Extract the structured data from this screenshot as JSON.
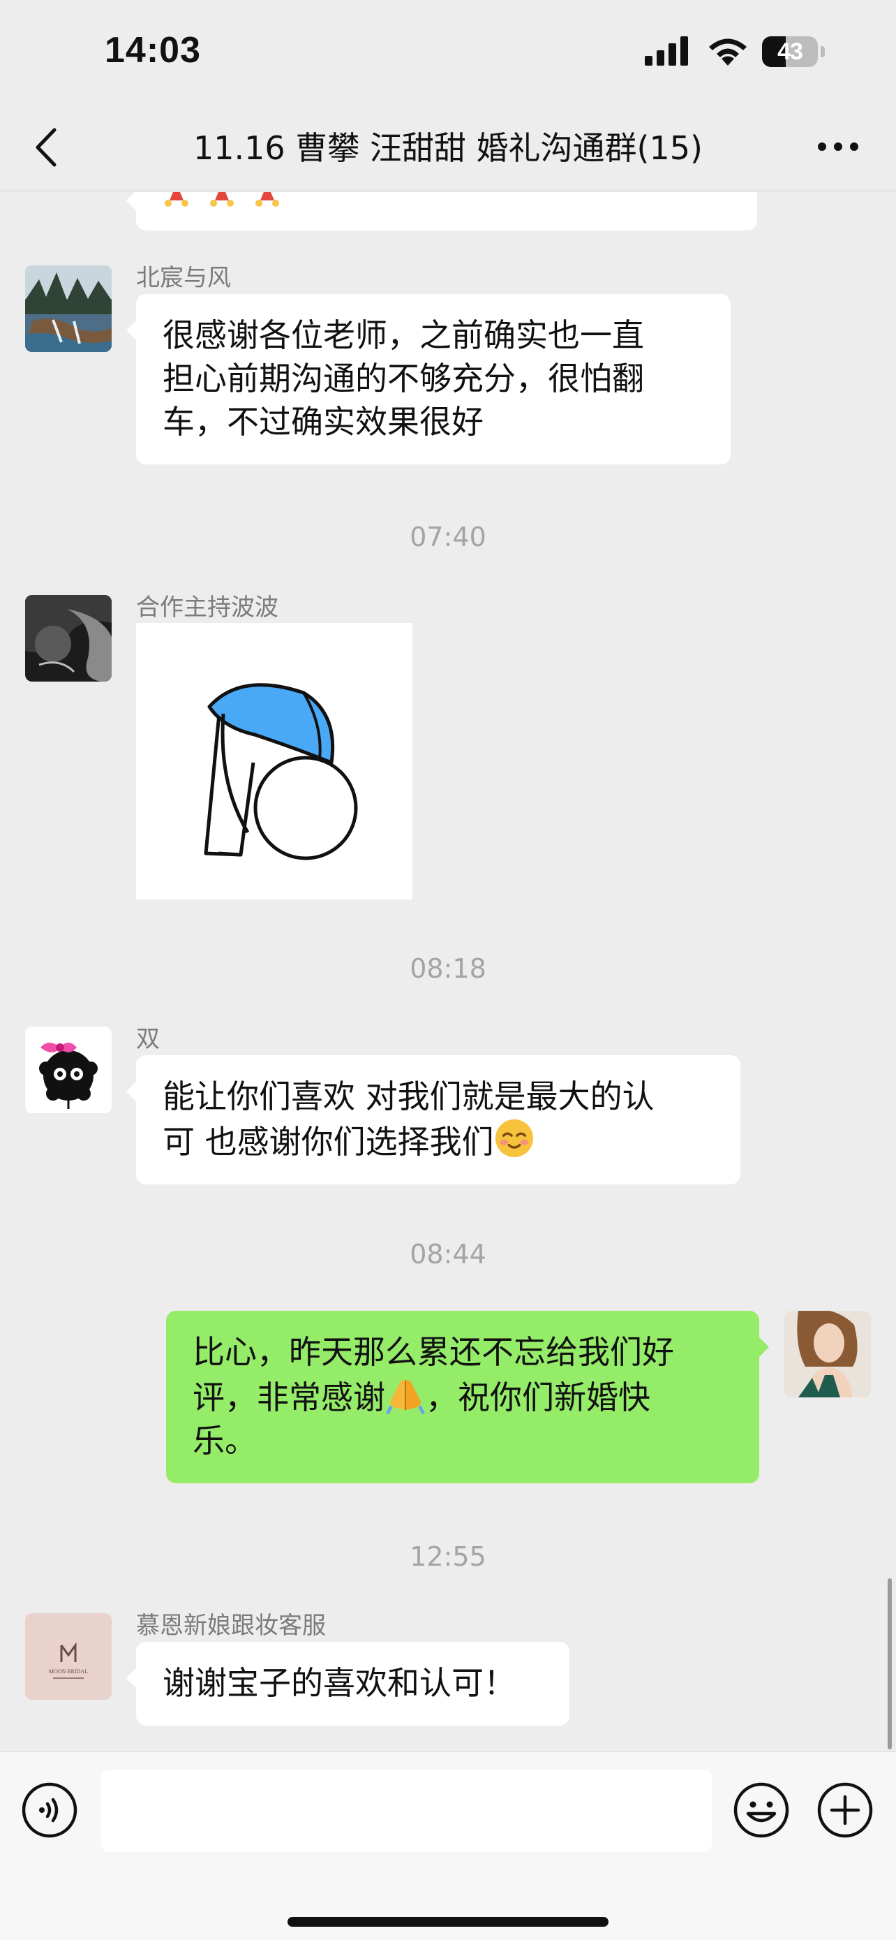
{
  "status_bar": {
    "time": "14:03",
    "battery_percent": "43",
    "battery_level": 0.43
  },
  "nav": {
    "title": "11.16 曹攀 汪甜甜 婚礼沟通群(15)"
  },
  "messages": [
    {
      "sender": "北宸与风",
      "lines": [
        "很感谢各位老师，之前确实也一直",
        "担心前期沟通的不够充分，很怕翻",
        "车，不过确实效果很好"
      ]
    },
    {
      "timestamp": "07:40"
    },
    {
      "sender": "合作主持波波",
      "type": "sticker",
      "sticker": "bowing-figure"
    },
    {
      "timestamp": "08:18"
    },
    {
      "sender": "双",
      "lines": [
        "能让你们喜欢 对我们就是最大的认",
        "可 也感谢你们选择我们"
      ],
      "emoji": "smiling-face"
    },
    {
      "timestamp": "08:44"
    },
    {
      "sender": "me",
      "lines": [
        "比心，昨天那么累还不忘给我们好",
        "评，非常感谢",
        "，祝你们新婚快",
        "乐。"
      ],
      "emoji": "folded-hands"
    },
    {
      "timestamp": "12:55"
    },
    {
      "sender": "慕恩新娘跟妆客服",
      "lines": [
        "谢谢宝子的喜欢和认可！"
      ]
    }
  ],
  "avatars": {
    "bride_logo_text": "MOON BRIDAL"
  },
  "colors": {
    "background": "#ededed",
    "my_bubble": "#95ec69",
    "other_bubble": "#ffffff",
    "timestamp": "#a4a4a4",
    "sender_name": "#7b7b7b"
  },
  "icons": [
    "back-arrow-icon",
    "more-icon",
    "voice-icon",
    "emoji-icon",
    "plus-icon",
    "signal-icon",
    "wifi-icon",
    "battery-icon"
  ],
  "input": {
    "value": "",
    "placeholder": ""
  }
}
